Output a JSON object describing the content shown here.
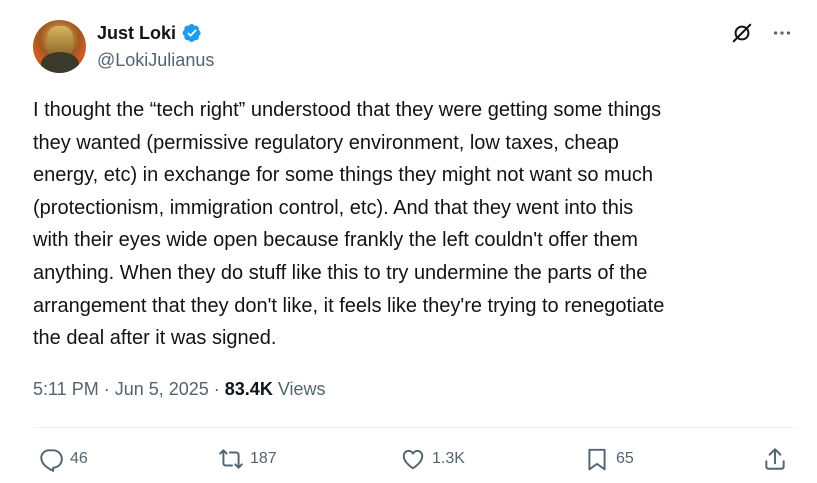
{
  "author": {
    "display_name": "Just Loki",
    "handle": "@LokiJulianus",
    "verified": true
  },
  "tweet": {
    "text": "I thought the “tech right” understood that they were getting some things\nthey wanted (permissive regulatory environment, low taxes, cheap\nenergy, etc) in exchange for some things they might not want so much\n(protectionism, immigration control, etc). And that they went into this\nwith their eyes wide open because frankly the left couldn't offer them\nanything. When they do stuff like this to try undermine the parts of the\narrangement that they don't like, it feels like they're trying to renegotiate\nthe deal after it was signed.",
    "time": "5:11 PM",
    "date": "Jun 5, 2025",
    "separator": "·",
    "views_count": "83.4K",
    "views_label": "Views"
  },
  "actions": {
    "replies": "46",
    "reposts": "187",
    "likes": "1.3K",
    "bookmarks": "65"
  },
  "colors": {
    "text": "#0f1419",
    "secondary": "#536471",
    "verified_badge": "#1d9bf0",
    "divider": "#eff3f4"
  },
  "icons": [
    "verified-badge-icon",
    "grok-icon",
    "more-icon",
    "reply-icon",
    "repost-icon",
    "like-icon",
    "bookmark-icon",
    "share-icon"
  ]
}
